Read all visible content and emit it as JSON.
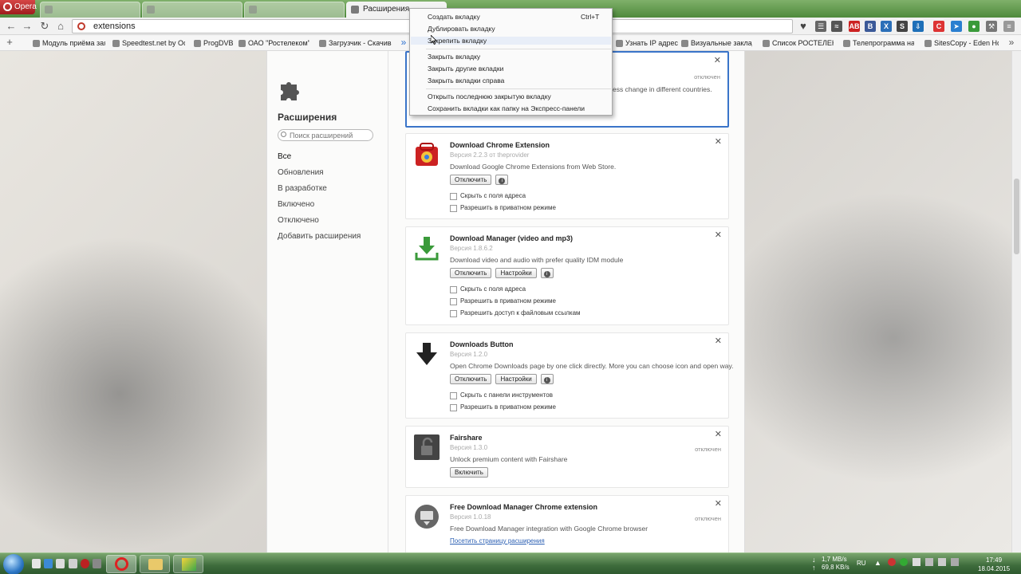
{
  "browser": {
    "menu_label": "Opera",
    "tabs": [
      {
        "label": "",
        "active": false
      },
      {
        "label": "",
        "active": false
      },
      {
        "label": "",
        "active": false
      },
      {
        "label": "Расширения",
        "active": true
      }
    ],
    "address": "extensions"
  },
  "bookmarks": [
    "Модуль приёма зая",
    "Speedtest.net by Ook",
    "ProgDVB",
    "ОАО \"Ростелеком\" /",
    "Загрузчик - Скачива",
    "Узнать IP адрес",
    "Визуальные заклад",
    "Список РОСТЕЛЕКС",
    "Телепрограмма на к",
    "SitesCopy - Eden Ho"
  ],
  "sidebar": {
    "title": "Расширения",
    "search_placeholder": "Поиск расширений",
    "items": [
      "Все",
      "Обновления",
      "В разработке",
      "Включено",
      "Отключено",
      "Добавить расширения"
    ]
  },
  "first_card": {
    "state": "отключен",
    "desc_fragment": "ess change in different countries."
  },
  "extensions": [
    {
      "name": "Download Chrome Extension",
      "version": "Версия 2.2.3 от theprovider",
      "description": "Download Google Chrome Extensions from Web Store.",
      "buttons": [
        "Отключить"
      ],
      "checks": [
        "Скрыть с поля адреса",
        "Разрешить в приватном режиме"
      ]
    },
    {
      "name": "Download Manager (video and mp3)",
      "version": "Версия 1.8.6.2",
      "description": "Download video and audio with prefer quality IDM module",
      "buttons": [
        "Отключить",
        "Настройки"
      ],
      "checks": [
        "Скрыть с поля адреса",
        "Разрешить в приватном режиме",
        "Разрешить доступ к файловым ссылкам"
      ]
    },
    {
      "name": "Downloads Button",
      "version": "Версия 1.2.0",
      "description": "Open Chrome Downloads page by one click directly. More you can choose icon and open way.",
      "buttons": [
        "Отключить",
        "Настройки"
      ],
      "checks": [
        "Скрыть с панели инструментов",
        "Разрешить в приватном режиме"
      ]
    },
    {
      "name": "Fairshare",
      "version": "Версия 1.3.0",
      "description": "Unlock premium content with Fairshare",
      "state": "отключен",
      "buttons": [
        "Включить"
      ]
    },
    {
      "name": "Free Download Manager Chrome extension",
      "version": "Версия 1.0.18",
      "description": "Free Download Manager integration with Google Chrome browser",
      "state": "отключен",
      "link": "Посетить страницу расширения"
    }
  ],
  "context_menu": {
    "items": [
      {
        "label": "Создать вкладку",
        "shortcut": "Ctrl+T"
      },
      {
        "label": "Дублировать вкладку"
      },
      {
        "label": "Закрепить вкладку"
      },
      {
        "label": "Закрыть вкладку"
      },
      {
        "label": "Закрыть другие вкладки"
      },
      {
        "label": "Закрыть вкладки справа"
      },
      {
        "label": "Открыть последнюю закрытую вкладку"
      },
      {
        "label": "Сохранить вкладки как папку на Экспресс-панели"
      }
    ]
  },
  "taskbar": {
    "lang": "RU",
    "speed_down": "1,7 MB/s",
    "speed_up": "69,8 KB/s",
    "time": "17:49",
    "date": "18.04.2015"
  },
  "colors": {
    "accent": "#3a74c9",
    "opera_red": "#c0392b",
    "taskbar": "#3d6b3b"
  }
}
